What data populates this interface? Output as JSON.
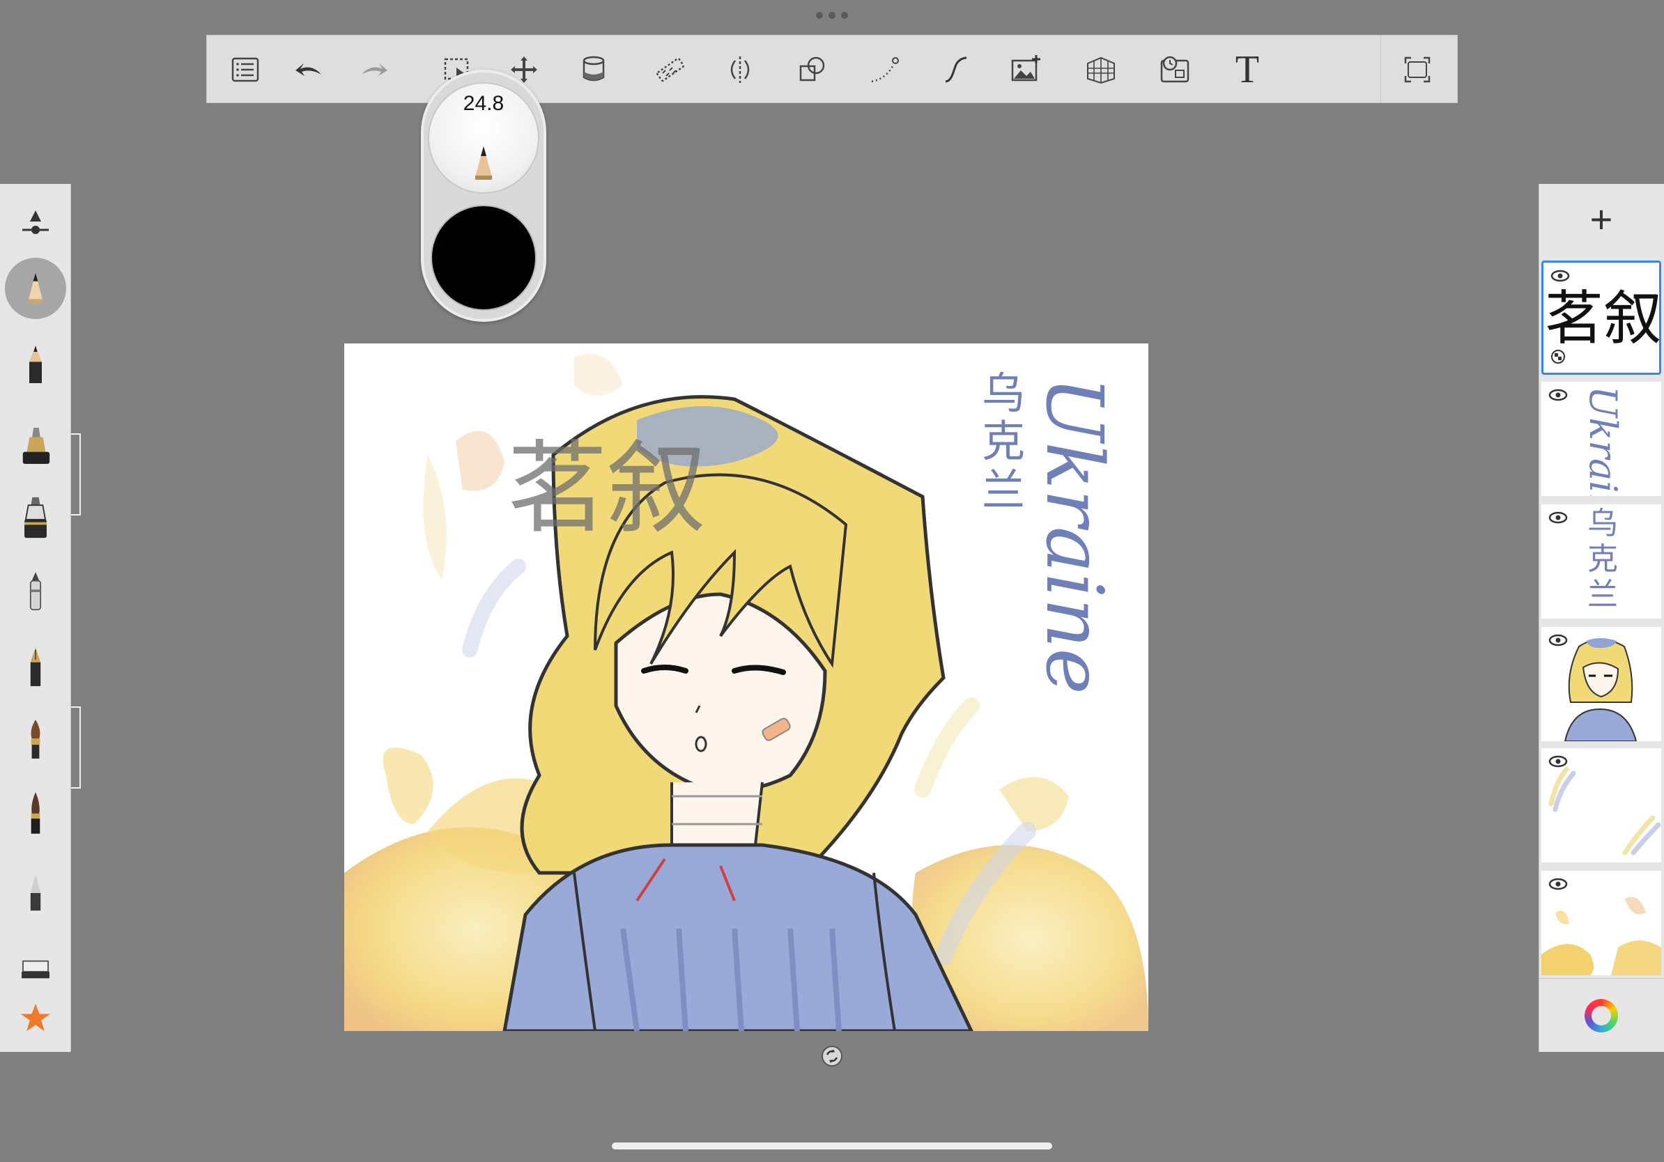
{
  "toolbar": {
    "items": [
      {
        "name": "layers-menu"
      },
      {
        "name": "undo"
      },
      {
        "name": "redo"
      },
      {
        "name": "selection"
      },
      {
        "name": "transform"
      },
      {
        "name": "fill"
      },
      {
        "name": "ruler"
      },
      {
        "name": "symmetry"
      },
      {
        "name": "shapes"
      },
      {
        "name": "curve"
      },
      {
        "name": "stroke-style"
      },
      {
        "name": "import-image"
      },
      {
        "name": "perspective"
      },
      {
        "name": "time-lapse"
      },
      {
        "name": "text"
      },
      {
        "name": "fullscreen"
      }
    ],
    "text_tool_label": "T"
  },
  "brush_puck": {
    "size_value": "24.8",
    "color": "#000000"
  },
  "brushes": [
    "opacity-size-slider",
    "pencil-selected",
    "pencil",
    "marker",
    "fountain-ink",
    "ballpoint",
    "fineliner",
    "paint-brush",
    "ink-brush",
    "soft-eraser-tip",
    "eraser",
    "favorites-star"
  ],
  "canvas": {
    "watermark_text": "茗叙",
    "title_latin": "Ukraine",
    "title_chinese": [
      "乌",
      "克",
      "兰"
    ]
  },
  "layers": {
    "add_label": "+",
    "items": [
      {
        "type": "watermark",
        "text": "茗叙",
        "active": true
      },
      {
        "type": "latin",
        "text": "Ukraine"
      },
      {
        "type": "chinese",
        "text": [
          "乌",
          "克",
          "兰"
        ]
      },
      {
        "type": "character"
      },
      {
        "type": "strokes"
      },
      {
        "type": "background"
      }
    ]
  },
  "colors": {
    "accent": "#3b86e0",
    "ukraine_blue": "#6f7fb8",
    "hair_yellow": "#f2d978",
    "dress_blue": "#9aaad8"
  }
}
